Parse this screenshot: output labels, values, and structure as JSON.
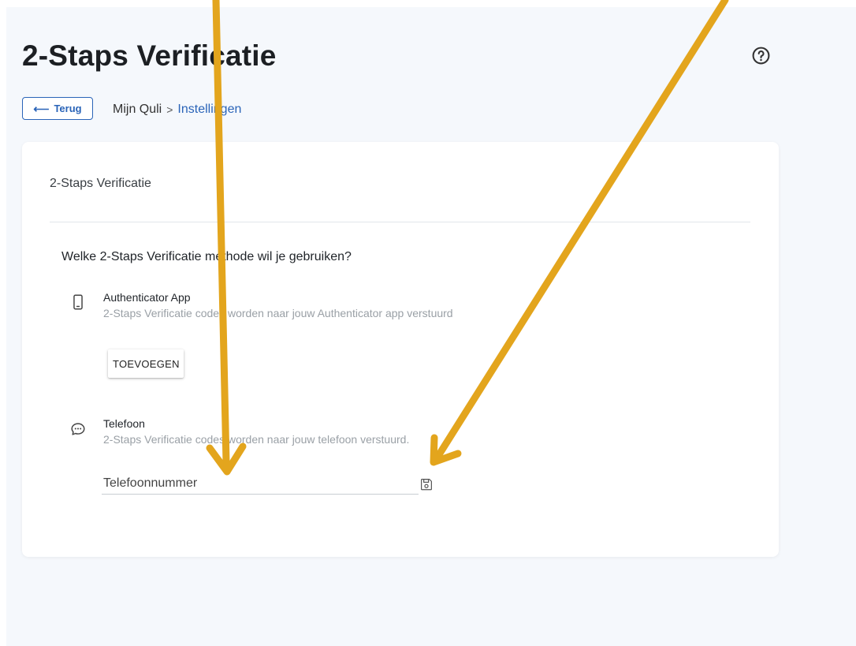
{
  "header": {
    "title": "2-Staps Verificatie",
    "help_icon": "help-circle-icon"
  },
  "nav": {
    "back_label": "Terug",
    "back_icon": "arrow-left-icon",
    "breadcrumb": {
      "home": "Mijn Quli",
      "separator": ">",
      "current": "Instellingen"
    }
  },
  "card": {
    "title": "2-Staps Verificatie",
    "question": "Welke 2-Staps Verificatie methode wil je gebruiken?",
    "methods": [
      {
        "icon": "smartphone-icon",
        "title": "Authenticator App",
        "description": "2-Staps Verificatie codes worden naar jouw Authenticator app verstuurd",
        "action_label": "TOEVOEGEN"
      },
      {
        "icon": "chat-bubble-icon",
        "title": "Telefoon",
        "description": "2-Staps Verificatie codes worden naar jouw telefoon verstuurd.",
        "input_placeholder": "Telefoonnummer",
        "input_value": "",
        "save_icon": "floppy-disk-icon"
      }
    ]
  },
  "colors": {
    "accent": "#2a64b8",
    "annotation_arrow": "#e3a51d",
    "background": "#f5f8fc"
  }
}
